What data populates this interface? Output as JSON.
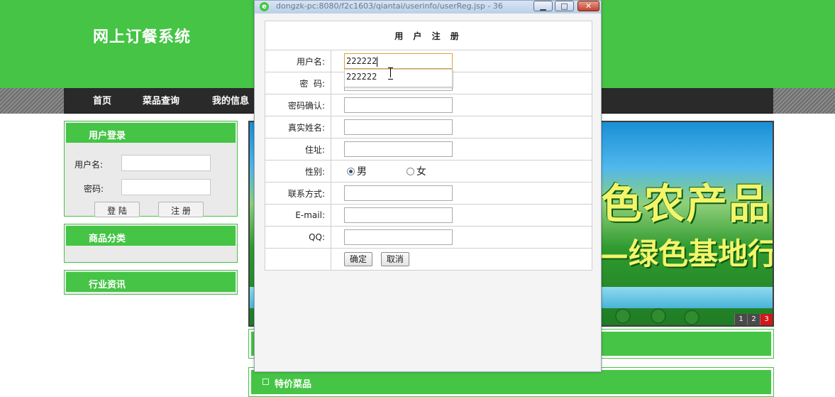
{
  "site": {
    "title": "网上订餐系统",
    "nav": [
      "首页",
      "菜品查询",
      "我的信息"
    ],
    "login_box": {
      "title": "用户登录",
      "username_label": "用户名:",
      "password_label": "密码:",
      "login_button": "登 陆",
      "register_button": "注 册"
    },
    "category_box_title": "商品分类",
    "news_box_title": "行业资讯",
    "banner": {
      "slogan_line1": "色农产品",
      "slogan_line2": "—绿色基地行",
      "pages": [
        "1",
        "2",
        "3"
      ],
      "active_page": "3"
    },
    "special_title": "特价菜品"
  },
  "popup": {
    "title": "dongzk-pc:8080/f2c1603/qiantai/userinfo/userReg.jsp - 36",
    "window_buttons": {
      "minimize": "▁",
      "maximize": "□",
      "close": "✕"
    },
    "form": {
      "heading": "用 户 注 册",
      "fields": [
        {
          "label": "用户名:",
          "value": "222222"
        },
        {
          "label": "密  码:",
          "value": ""
        },
        {
          "label": "密码确认:",
          "value": ""
        },
        {
          "label": "真实姓名:",
          "value": ""
        },
        {
          "label": "住址:",
          "value": ""
        }
      ],
      "gender": {
        "label": "性别:",
        "male": "男",
        "female": "女",
        "selected": "男"
      },
      "fields2": [
        {
          "label": "联系方式:",
          "value": ""
        },
        {
          "label": "E-mail:",
          "value": ""
        },
        {
          "label": "QQ:",
          "value": ""
        }
      ],
      "confirm_button": "确定",
      "cancel_button": "取消"
    },
    "autocomplete_suggestion": "222222"
  },
  "colors": {
    "site_green": "#45c445",
    "focus_border": "#e2a23b"
  }
}
